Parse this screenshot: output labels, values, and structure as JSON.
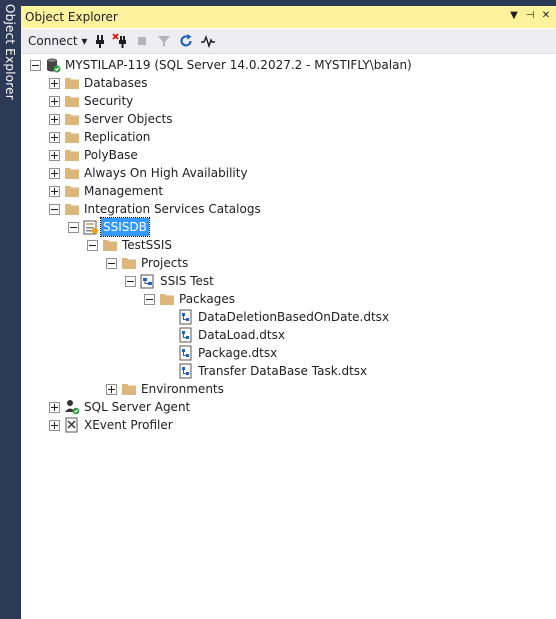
{
  "sidebar": {
    "tab_label": "Object Explorer"
  },
  "panel": {
    "title": "Object Explorer",
    "controls": {
      "dropdown": "▼",
      "pin": "⊣",
      "close": "✕"
    }
  },
  "toolbar": {
    "connect_label": "Connect ▾"
  },
  "tree": {
    "server": "MYSTILAP-119 (SQL Server 14.0.2027.2 - MYSTIFLY\\balan)",
    "databases": "Databases",
    "security": "Security",
    "server_objects": "Server Objects",
    "replication": "Replication",
    "polybase": "PolyBase",
    "always_on": "Always On High Availability",
    "management": "Management",
    "isc": "Integration Services Catalogs",
    "ssisdb": "SSISDB",
    "testssis": "TestSSIS",
    "projects": "Projects",
    "ssis_test": "SSIS Test",
    "packages": "Packages",
    "pkg1": "DataDeletionBasedOnDate.dtsx",
    "pkg2": "DataLoad.dtsx",
    "pkg3": "Package.dtsx",
    "pkg4": "Transfer DataBase Task.dtsx",
    "environments": "Environments",
    "sql_agent": "SQL Server Agent",
    "xevent": "XEvent Profiler"
  },
  "colors": {
    "title_bg": "#fff29d",
    "selection": "#3399ff",
    "folder": "#dcb67a",
    "chrome": "#2d3a55"
  }
}
